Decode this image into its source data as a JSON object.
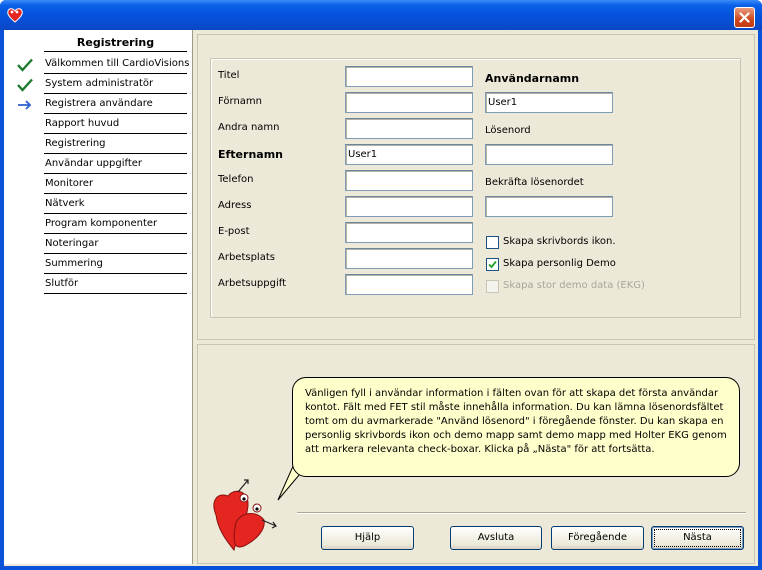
{
  "window": {
    "icon": "heart-app-icon",
    "close_icon": "close-icon"
  },
  "sidebar": {
    "title": "Registrering",
    "items": [
      {
        "label": "Välkommen till CardioVisions",
        "status": "done"
      },
      {
        "label": "System administratör",
        "status": "done"
      },
      {
        "label": "Registrera användare",
        "status": "current"
      },
      {
        "label": "Rapport huvud",
        "status": "pending"
      },
      {
        "label": "Registrering",
        "status": "pending"
      },
      {
        "label": "Användar uppgifter",
        "status": "pending"
      },
      {
        "label": "Monitorer",
        "status": "pending"
      },
      {
        "label": "Nätverk",
        "status": "pending"
      },
      {
        "label": "Program komponenter",
        "status": "pending"
      },
      {
        "label": "Noteringar",
        "status": "pending"
      },
      {
        "label": "Summering",
        "status": "pending"
      },
      {
        "label": "Slutför",
        "status": "pending"
      }
    ]
  },
  "form": {
    "left_fields": [
      {
        "label": "Titel",
        "value": "",
        "bold": false
      },
      {
        "label": "Förnamn",
        "value": "",
        "bold": false
      },
      {
        "label": "Andra namn",
        "value": "",
        "bold": false
      },
      {
        "label": "Efternamn",
        "value": "User1",
        "bold": true
      },
      {
        "label": "Telefon",
        "value": "",
        "bold": false
      },
      {
        "label": "Adress",
        "value": "",
        "bold": false
      },
      {
        "label": "E-post",
        "value": "",
        "bold": false
      },
      {
        "label": "Arbetsplats",
        "value": "",
        "bold": false
      },
      {
        "label": "Arbetsuppgift",
        "value": "",
        "bold": false
      }
    ],
    "username_label": "Användarnamn",
    "username_value": "User1",
    "password_label": "Lösenord",
    "password_value": "",
    "confirm_label": "Bekräfta lösenordet",
    "confirm_value": "",
    "checkboxes": [
      {
        "label": "Skapa skrivbords ikon.",
        "checked": false,
        "enabled": true
      },
      {
        "label": "Skapa personlig Demo",
        "checked": true,
        "enabled": true
      },
      {
        "label": "Skapa stor demo data (EKG)",
        "checked": false,
        "enabled": false
      }
    ]
  },
  "help_text": "Vänligen fyll i användar information i fälten ovan för att skapa det första användar kontot. Fält med FET stil måste innehålla information. Du kan lämna lösenordsfältet tomt om du avmarkerade \"Använd lösenord\" i föregående fönster. Du kan skapa en personlig skrivbords ikon och demo mapp samt demo mapp med Holter EKG genom att markera relevanta check-boxar. Klicka på „Nästa\" för att fortsätta.",
  "buttons": {
    "help": "Hjälp",
    "cancel": "Avsluta",
    "back": "Föregående",
    "next": "Nästa"
  },
  "colors": {
    "titlebar": "#0552db",
    "dialog_bg": "#ece9d8",
    "bubble_bg": "#ffffcc",
    "done_check": "#1e7a2e",
    "current_arrow": "#2a5fd0",
    "mascot_red": "#e52520"
  }
}
